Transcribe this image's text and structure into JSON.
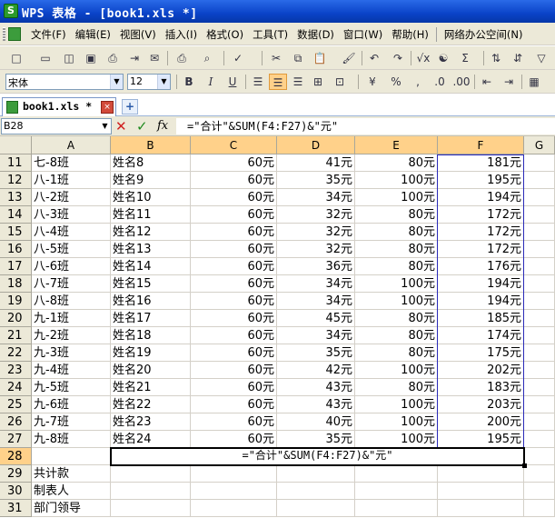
{
  "window": {
    "title": "WPS 表格 - [book1.xls *]",
    "app_icon": "S"
  },
  "menu": [
    "文件(F)",
    "编辑(E)",
    "视图(V)",
    "插入(I)",
    "格式(O)",
    "工具(T)",
    "数据(D)",
    "窗口(W)",
    "帮助(H)",
    "网络办公空间(N)"
  ],
  "toolbar": {
    "font_name": "宋体",
    "font_size": "12",
    "bold": "B",
    "italic": "I",
    "underline": "U",
    "percent": "%",
    "sum": "Σ"
  },
  "tabs": {
    "active": "book1.xls *",
    "close_glyph": "×",
    "new_tab_glyph": "+"
  },
  "formula_bar": {
    "cell_ref": "B28",
    "cancel": "✕",
    "confirm": "✓",
    "fx": "fx",
    "content": "=\"合计\"&SUM(F4:F27)&\"元\""
  },
  "columns": [
    "A",
    "B",
    "C",
    "D",
    "E",
    "F",
    "G"
  ],
  "rows": [
    {
      "n": "11",
      "a": "七-8班",
      "b": "姓名8",
      "c": "60元",
      "d": "41元",
      "e": "80元",
      "f": "181元"
    },
    {
      "n": "12",
      "a": "八-1班",
      "b": "姓名9",
      "c": "60元",
      "d": "35元",
      "e": "100元",
      "f": "195元"
    },
    {
      "n": "13",
      "a": "八-2班",
      "b": "姓名10",
      "c": "60元",
      "d": "34元",
      "e": "100元",
      "f": "194元"
    },
    {
      "n": "14",
      "a": "八-3班",
      "b": "姓名11",
      "c": "60元",
      "d": "32元",
      "e": "80元",
      "f": "172元"
    },
    {
      "n": "15",
      "a": "八-4班",
      "b": "姓名12",
      "c": "60元",
      "d": "32元",
      "e": "80元",
      "f": "172元"
    },
    {
      "n": "16",
      "a": "八-5班",
      "b": "姓名13",
      "c": "60元",
      "d": "32元",
      "e": "80元",
      "f": "172元"
    },
    {
      "n": "17",
      "a": "八-6班",
      "b": "姓名14",
      "c": "60元",
      "d": "36元",
      "e": "80元",
      "f": "176元"
    },
    {
      "n": "18",
      "a": "八-7班",
      "b": "姓名15",
      "c": "60元",
      "d": "34元",
      "e": "100元",
      "f": "194元"
    },
    {
      "n": "19",
      "a": "八-8班",
      "b": "姓名16",
      "c": "60元",
      "d": "34元",
      "e": "100元",
      "f": "194元"
    },
    {
      "n": "20",
      "a": "九-1班",
      "b": "姓名17",
      "c": "60元",
      "d": "45元",
      "e": "80元",
      "f": "185元"
    },
    {
      "n": "21",
      "a": "九-2班",
      "b": "姓名18",
      "c": "60元",
      "d": "34元",
      "e": "80元",
      "f": "174元"
    },
    {
      "n": "22",
      "a": "九-3班",
      "b": "姓名19",
      "c": "60元",
      "d": "35元",
      "e": "80元",
      "f": "175元"
    },
    {
      "n": "23",
      "a": "九-4班",
      "b": "姓名20",
      "c": "60元",
      "d": "42元",
      "e": "100元",
      "f": "202元"
    },
    {
      "n": "24",
      "a": "九-5班",
      "b": "姓名21",
      "c": "60元",
      "d": "43元",
      "e": "80元",
      "f": "183元"
    },
    {
      "n": "25",
      "a": "九-6班",
      "b": "姓名22",
      "c": "60元",
      "d": "43元",
      "e": "100元",
      "f": "203元"
    },
    {
      "n": "26",
      "a": "九-7班",
      "b": "姓名23",
      "c": "60元",
      "d": "40元",
      "e": "100元",
      "f": "200元"
    },
    {
      "n": "27",
      "a": "九-8班",
      "b": "姓名24",
      "c": "60元",
      "d": "35元",
      "e": "100元",
      "f": "195元"
    },
    {
      "n": "28",
      "a": "",
      "b": "",
      "c": "",
      "d": "",
      "e": "",
      "f": ""
    },
    {
      "n": "29",
      "a": "共计款",
      "b": "",
      "c": "",
      "d": "",
      "e": "",
      "f": ""
    },
    {
      "n": "30",
      "a": "制表人",
      "b": "",
      "c": "",
      "d": "",
      "e": "",
      "f": ""
    },
    {
      "n": "31",
      "a": "部门领导",
      "b": "",
      "c": "",
      "d": "",
      "e": "",
      "f": ""
    }
  ],
  "active_cell": {
    "ref": "B28",
    "editing_text": "=\"合计\"&SUM(F4:F27)&\"元\""
  }
}
